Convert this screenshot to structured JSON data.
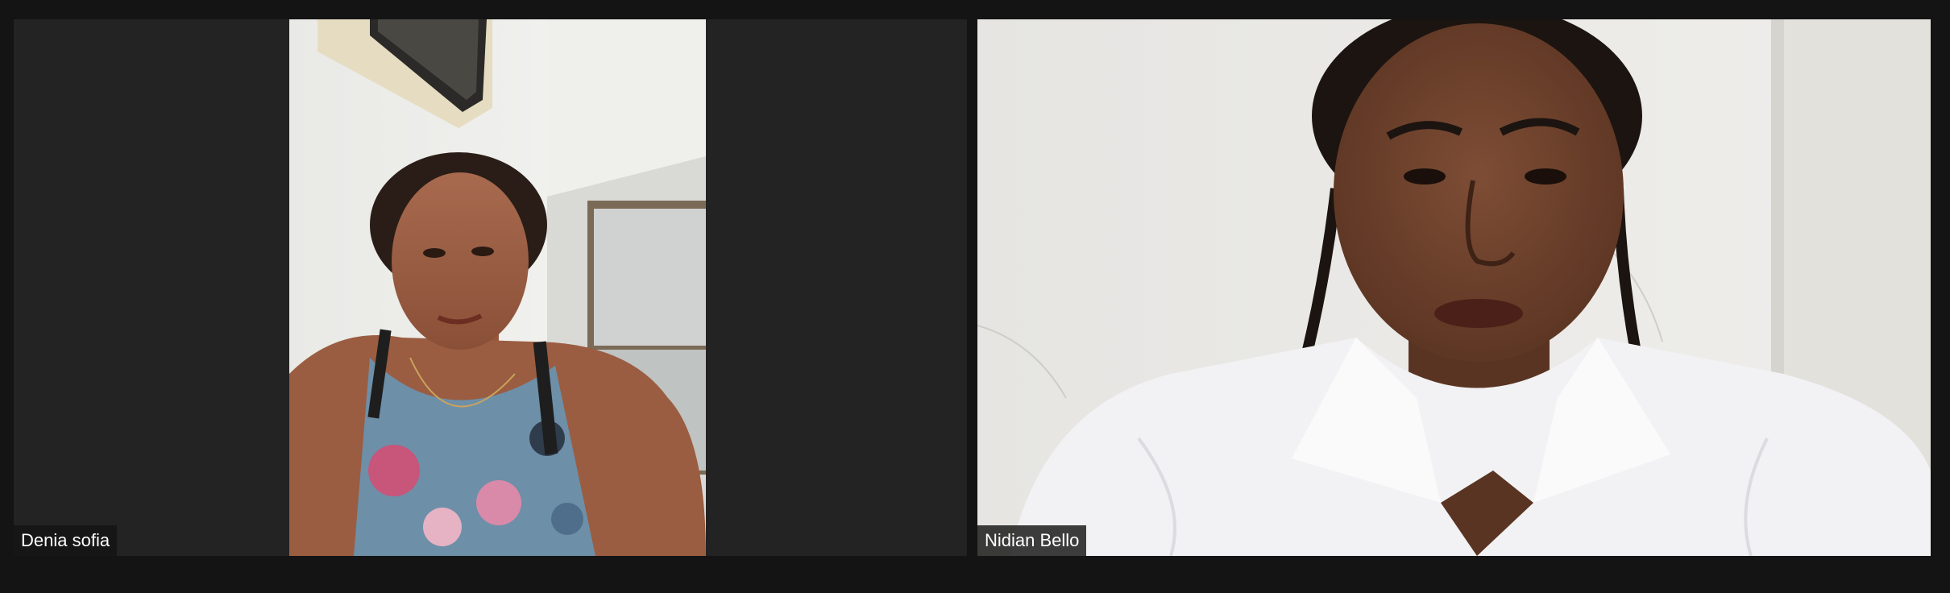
{
  "meeting": {
    "participants": [
      {
        "name": "Denia sofia",
        "video": "on"
      },
      {
        "name": "Nidian Bello",
        "video": "on"
      }
    ]
  },
  "colors": {
    "background": "#141414",
    "tile_background": "#232323",
    "label_background": "#141414",
    "label_text": "#ffffff"
  }
}
